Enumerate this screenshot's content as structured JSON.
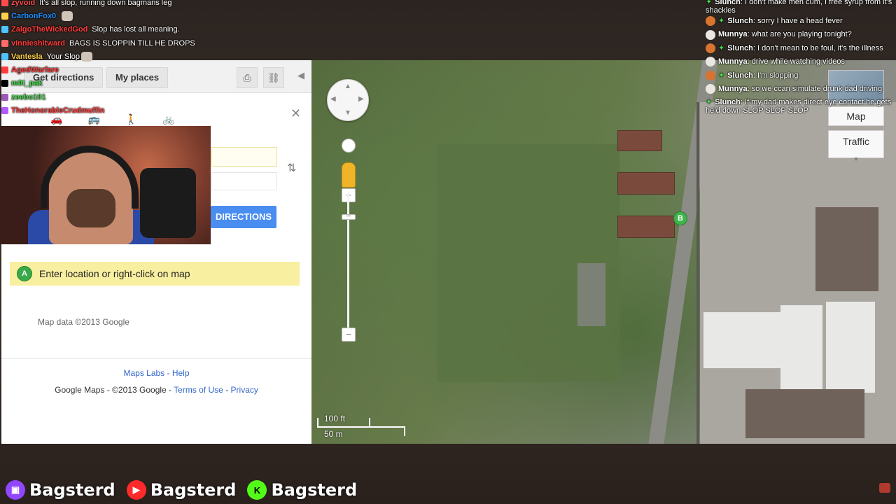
{
  "chat_left": [
    {
      "user": "zyvoid",
      "color": "#ff4b4b",
      "badge": "#ff4b4b",
      "msg": "It's all slop, running down bagmans leg"
    },
    {
      "user": "CarbonFox0",
      "color": "#1e90ff",
      "badge": "#ffd24d",
      "msg": ""
    },
    {
      "user": "ZalgoTheWickedGod",
      "color": "#ff3b3b",
      "badge": "#4dc3ff",
      "msg": "Slop has lost all meaning."
    },
    {
      "user": "vinnieshitward",
      "color": "#ff3b3b",
      "badge": "#ff6a6a",
      "msg": "BAGS IS SLOPPIN TILL HE DROPS"
    },
    {
      "user": "Vantesla",
      "color": "#ffd24d",
      "badge": "#4dc3ff",
      "msg": "Your Slop"
    },
    {
      "user": "AgedWarfare",
      "color": "#ff3b3b",
      "badge": "#ff3b3b",
      "msg": ""
    },
    {
      "user": "m0t_pak",
      "color": "#46d94d",
      "badge": "#000000",
      "msg": ""
    },
    {
      "user": "zeebo101",
      "color": "#46d94d",
      "badge": "#9b59b6",
      "msg": ""
    },
    {
      "user": "TheHonorableCrudmuffin",
      "color": "#ff3b3b",
      "badge": "#b05cff",
      "msg": ""
    }
  ],
  "sidebar": {
    "get_directions": "Get directions",
    "my_places": "My places",
    "go_button": "DIRECTIONS",
    "hint_pin": "A",
    "hint_text": "Enter location or right-click on map",
    "map_data": "Map data ©2013 Google",
    "links": {
      "labs": "Maps Labs",
      "sep": " - ",
      "help": "Help"
    },
    "copyright": {
      "prefix": "Google Maps - ©2013 Google - ",
      "terms": "Terms of Use",
      "sep": " - ",
      "privacy": "Privacy"
    }
  },
  "map": {
    "type_button": "Map",
    "traffic_button": "Traffic",
    "pin_b": "B",
    "scale_ft": "100 ft",
    "scale_m": "50 m"
  },
  "chat_right": [
    {
      "user": "Slunch",
      "msg": "I don't make men cum, I free syrup from it's shackles",
      "mod": true,
      "wrap": true
    },
    {
      "user": "Slunch",
      "msg": "sorry I have a head fever",
      "mod": true
    },
    {
      "user": "Munnya",
      "msg": "what are you playing tonight?",
      "mod": false
    },
    {
      "user": "Slunch",
      "msg": "I don't mean to be foul, it's the illness",
      "mod": true
    },
    {
      "user": "Munnya",
      "msg": "drive while watching videos",
      "mod": false
    },
    {
      "user": "Slunch",
      "msg": "I'm slopping",
      "mod": true
    },
    {
      "user": "Munnya",
      "msg": "so we ccan simulate drunk dad driving",
      "mod": false
    },
    {
      "user": "Slunch",
      "msg": "If my dad makes direct eye contact he gets held down SLOP SLOP SLOP",
      "mod": true,
      "wrap": true
    }
  ],
  "bottom": [
    {
      "icon": "twitch-icon",
      "name": "Bagsterd",
      "color": "#9146ff"
    },
    {
      "icon": "youtube-icon",
      "name": "Bagsterd",
      "color": "#ff2b2b"
    },
    {
      "icon": "kick-icon",
      "name": "Bagsterd",
      "color": "#53fc18"
    }
  ]
}
